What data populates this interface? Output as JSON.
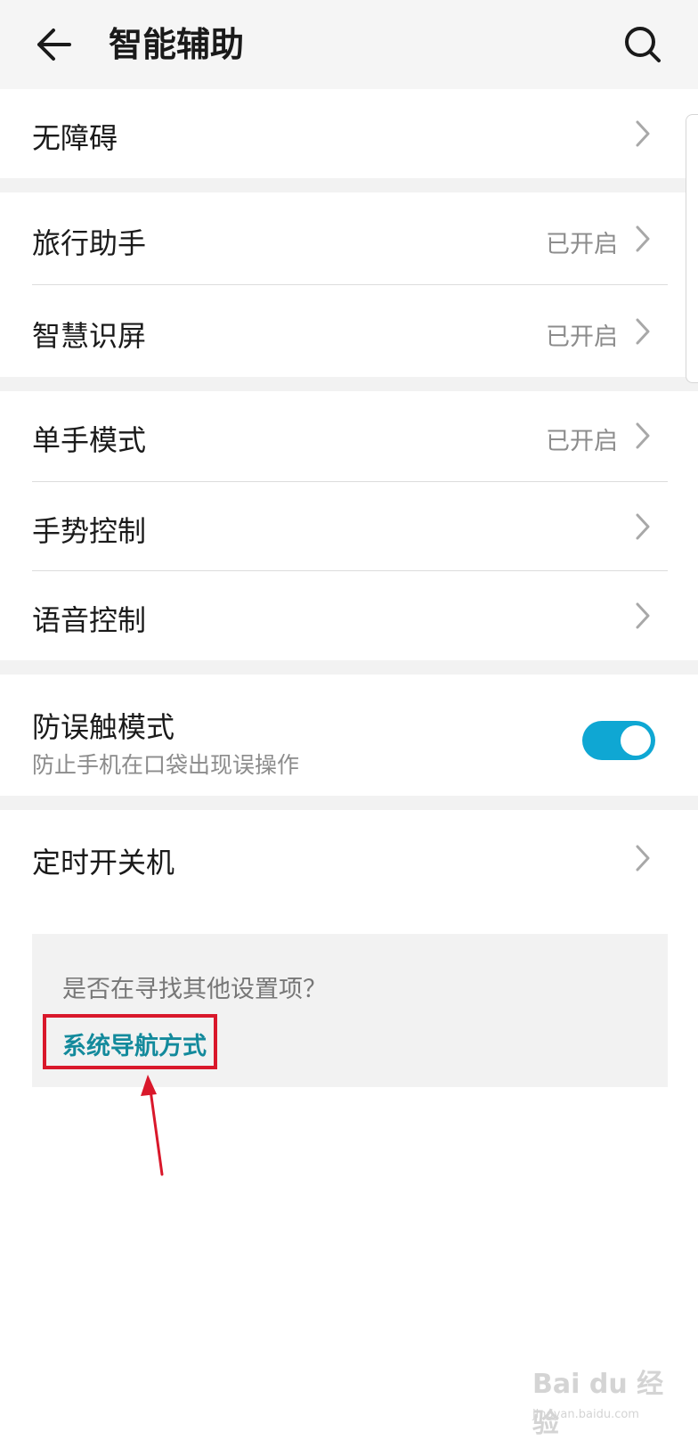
{
  "header": {
    "title": "智能辅助",
    "back_icon": "arrow-left-icon",
    "search_icon": "search-icon"
  },
  "groups": [
    {
      "items": [
        {
          "label": "无障碍",
          "status": ""
        }
      ]
    },
    {
      "items": [
        {
          "label": "旅行助手",
          "status": "已开启"
        },
        {
          "label": "智慧识屏",
          "status": "已开启"
        }
      ]
    },
    {
      "items": [
        {
          "label": "单手模式",
          "status": "已开启"
        },
        {
          "label": "手势控制",
          "status": ""
        },
        {
          "label": "语音控制",
          "status": ""
        }
      ]
    }
  ],
  "toggle_item": {
    "label": "防误触模式",
    "sublabel": "防止手机在口袋出现误操作",
    "on": true
  },
  "timer_item": {
    "label": "定时开关机"
  },
  "suggest": {
    "question": "是否在寻找其他设置项？",
    "link": "系统导航方式"
  },
  "watermark": {
    "text": "Bai du 经验",
    "sub": "jingyan.baidu.com"
  },
  "colors": {
    "accent": "#0fa7d3",
    "link": "#138a9c",
    "highlight": "#d9182b",
    "header_bg": "#f5f5f5",
    "gap_bg": "#f2f2f2"
  }
}
